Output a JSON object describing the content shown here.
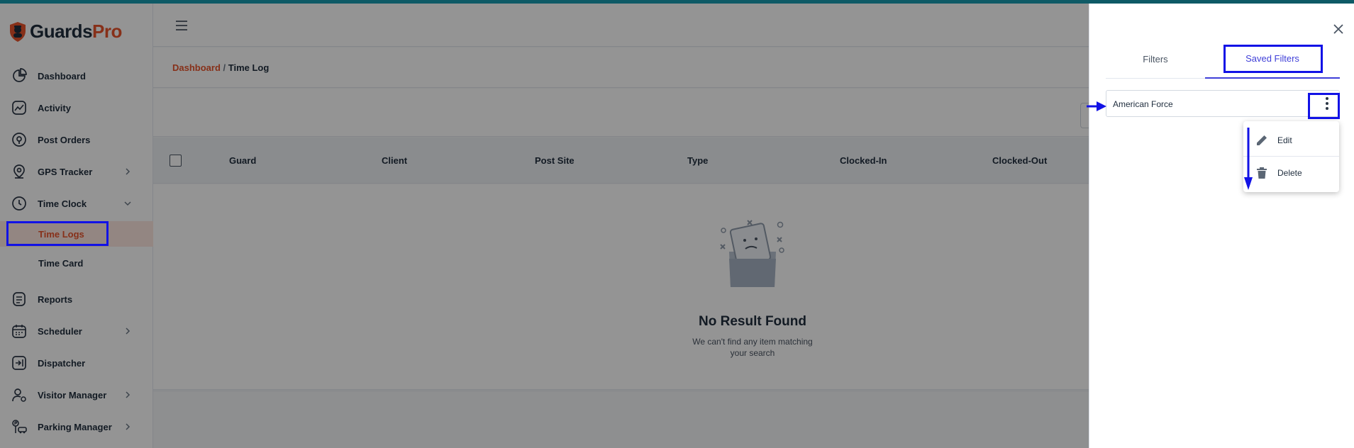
{
  "app": {
    "brand_part1": "Guards",
    "brand_part2": "Pro",
    "brand_color": "#e8542b",
    "dark_text_color": "#1f2d3d"
  },
  "sidebar": {
    "items": [
      {
        "label": "Dashboard",
        "icon": "pie-chart-icon"
      },
      {
        "label": "Activity",
        "icon": "trend-line-icon"
      },
      {
        "label": "Post Orders",
        "icon": "location-badge-icon"
      },
      {
        "label": "GPS Tracker",
        "icon": "map-pin-icon"
      },
      {
        "label": "Time Clock",
        "icon": "clock-icon"
      },
      {
        "label": "Time Logs",
        "icon": "",
        "active": true
      },
      {
        "label": "Time Card",
        "icon": ""
      },
      {
        "label": "Reports",
        "icon": "document-list-icon"
      },
      {
        "label": "Scheduler",
        "icon": "calendar-icon"
      },
      {
        "label": "Dispatcher",
        "icon": "dispatch-icon"
      },
      {
        "label": "Visitor Manager",
        "icon": "user-settings-icon"
      },
      {
        "label": "Parking Manager",
        "icon": "parking-icon"
      }
    ]
  },
  "breadcrumb": {
    "link": "Dashboard",
    "separator": " / ",
    "current": "Time Log"
  },
  "table": {
    "columns": [
      "Guard",
      "Client",
      "Post Site",
      "Type",
      "Clocked-In",
      "Clocked-Out"
    ]
  },
  "empty_state": {
    "title": "No Result Found",
    "message": "We can't find any item matching your search"
  },
  "drawer": {
    "tabs": {
      "filters": "Filters",
      "saved_filters": "Saved Filters"
    },
    "active_tab": "Saved Filters",
    "saved_filter_name": "American Force",
    "menu": {
      "edit": "Edit",
      "delete": "Delete"
    },
    "accent_color": "#3f3fd8"
  },
  "annotation_color": "#1212e6"
}
